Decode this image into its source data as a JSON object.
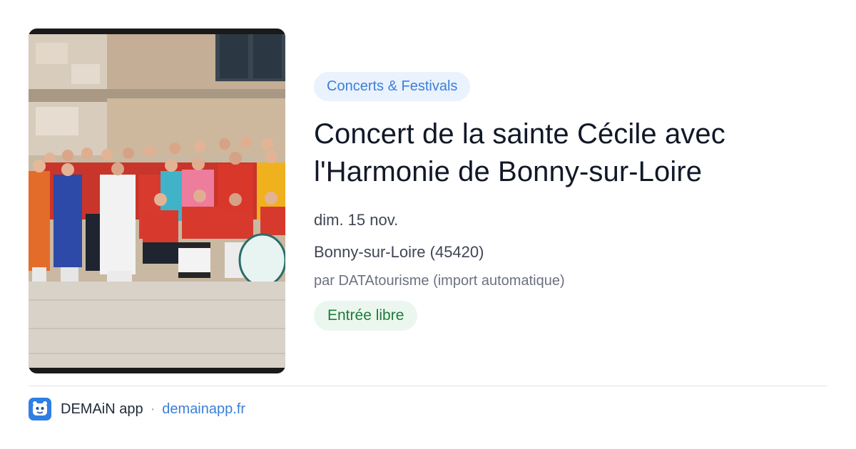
{
  "card": {
    "image_alt": "Photo de groupe de l'Harmonie devant l'église",
    "category": "Concerts & Festivals",
    "title": "Concert de la sainte Cécile avec l'Harmonie de Bonny-sur-Loire",
    "date": "dim. 15 nov.",
    "location": "Bonny-sur-Loire (45420)",
    "source": "par DATAtourisme (import automatique)",
    "price": "Entrée libre"
  },
  "footer": {
    "app_name": "DEMAiN app",
    "separator": "·",
    "link": "demainapp.fr",
    "logo_icon": "demain-logo-icon"
  },
  "colors": {
    "category_bg": "#eaf2fd",
    "category_text": "#3b7fd9",
    "price_bg": "#ebf7ee",
    "price_text": "#1f7a3a",
    "logo_bg": "#2f7fe4"
  }
}
